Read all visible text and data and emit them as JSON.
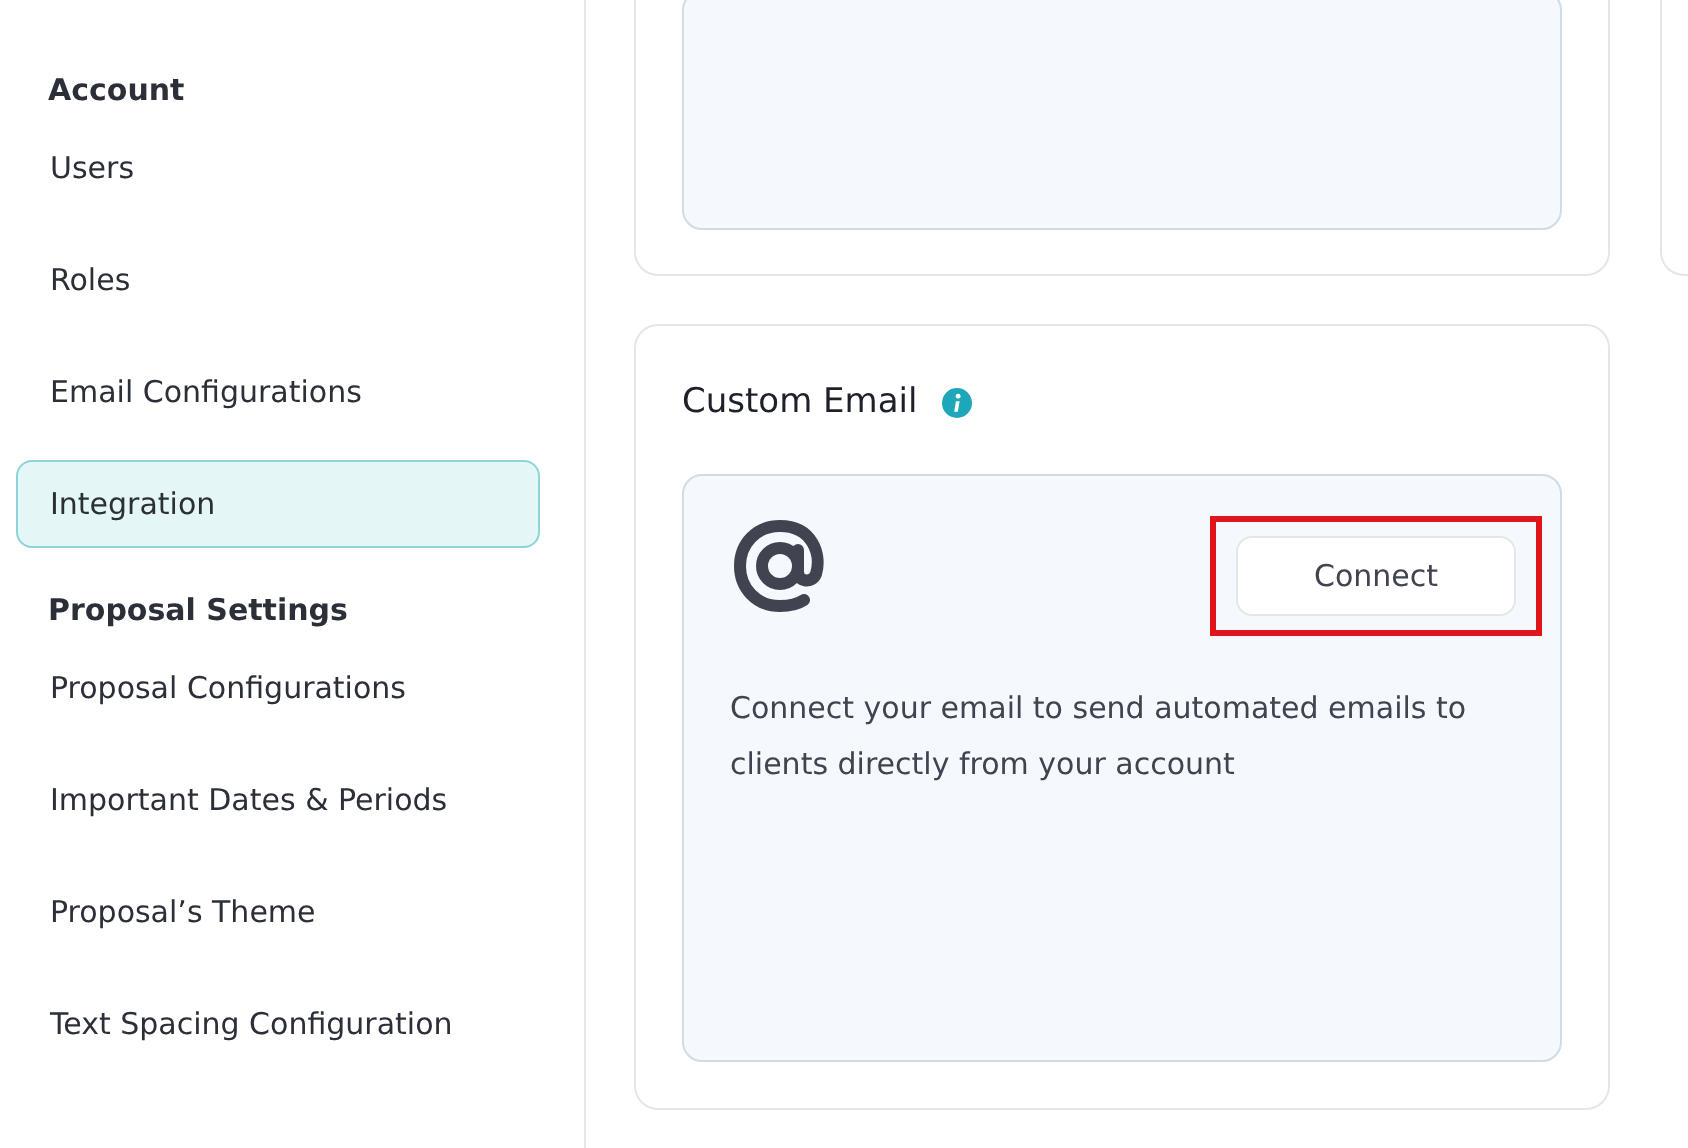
{
  "sidebar": {
    "groups": [
      {
        "heading": "Account",
        "items": [
          {
            "label": "Users",
            "selected": false
          },
          {
            "label": "Roles",
            "selected": false
          },
          {
            "label": "Email Configurations",
            "selected": false
          },
          {
            "label": "Integration",
            "selected": true
          }
        ]
      },
      {
        "heading": "Proposal Settings",
        "items": [
          {
            "label": "Proposal Configurations",
            "selected": false
          },
          {
            "label": "Important Dates & Periods",
            "selected": false
          },
          {
            "label": "Proposal’s Theme",
            "selected": false
          },
          {
            "label": "Text Spacing Configuration",
            "selected": false
          }
        ]
      }
    ]
  },
  "integrations": [
    {
      "title": "Custom Email",
      "description": "Connect your email to send automated emails to clients directly from your account",
      "button": {
        "label": "Connect",
        "highlighted": true
      }
    }
  ]
}
